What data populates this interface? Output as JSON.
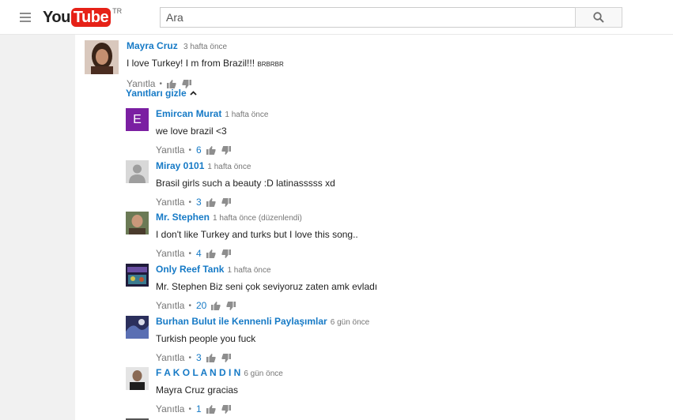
{
  "header": {
    "logo_you": "You",
    "logo_tube": "Tube",
    "logo_region": "TR",
    "search_placeholder": "Ara"
  },
  "colors": {
    "accent": "#167ac6",
    "brand": "#e62117",
    "meta": "#767676"
  },
  "top_comment": {
    "author": "Mayra Cruz",
    "time": "3 hafta önce",
    "text": "I love Turkey! I m from Brazil!!!",
    "text_tail": "BRBRBR",
    "reply_label": "Yanıtla",
    "avatar_icon": "user-photo"
  },
  "replies_toggle": {
    "label": "Yanıtları gizle",
    "icon": "chevron-up-icon"
  },
  "replies": [
    {
      "author": "Emircan Murat",
      "time": "1 hafta önce",
      "text": "we love brazil <3",
      "reply_label": "Yanıtla",
      "likes": "6",
      "avatar_letter": "E",
      "avatar_type": "letter"
    },
    {
      "author": "Miray 0101",
      "time": "1 hafta önce",
      "text": "Brasil girls such a beauty :D latinasssss xd",
      "reply_label": "Yanıtla",
      "likes": "3",
      "avatar_type": "default"
    },
    {
      "author": "Mr. Stephen",
      "time": "1 hafta önce (düzenlendi)",
      "text": "I don't like Turkey and turks but I love this song..",
      "reply_label": "Yanıtla",
      "likes": "4",
      "avatar_type": "photo"
    },
    {
      "author": "Only Reef Tank",
      "time": "1 hafta önce",
      "text": "Mr. Stephen Biz seni çok seviyoruz zaten amk evladı",
      "reply_label": "Yanıtla",
      "likes": "20",
      "avatar_type": "photo"
    },
    {
      "author": "Burhan Bulut ile Kennenli Paylaşımlar",
      "time": "6 gün önce",
      "text": "Turkish people you fuck",
      "reply_label": "Yanıtla",
      "likes": "3",
      "avatar_type": "photo"
    },
    {
      "author": "F A K O L A N D I N",
      "time": "6 gün önce",
      "text": "Mayra Cruz gracias",
      "reply_label": "Yanıtla",
      "likes": "1",
      "avatar_type": "photo"
    }
  ]
}
